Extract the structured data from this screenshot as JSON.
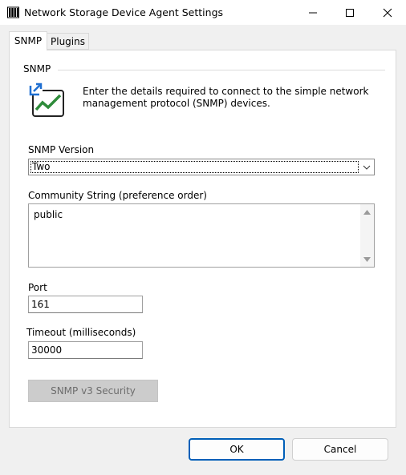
{
  "window": {
    "title": "Network Storage Device Agent Settings",
    "icon": "book-stack-icon",
    "controls": [
      "minimize-icon",
      "maximize-icon",
      "close-icon"
    ]
  },
  "tabs": [
    {
      "label": "SNMP",
      "selected": true
    },
    {
      "label": "Plugins",
      "selected": false
    }
  ],
  "snmp": {
    "group_label": "SNMP",
    "icon": "snmp-chart-icon",
    "intro": "Enter the details required to connect to the simple network management protocol (SNMP) devices.",
    "version": {
      "label": "SNMP Version",
      "value": "Two"
    },
    "community": {
      "label": "Community String (preference order)",
      "value": "public"
    },
    "port": {
      "label": "Port",
      "value": "161"
    },
    "timeout": {
      "label": "Timeout (milliseconds)",
      "value": "30000"
    },
    "v3_security_button": "SNMP v3 Security"
  },
  "footer": {
    "ok_label": "OK",
    "cancel_label": "Cancel"
  },
  "colors": {
    "accent": "#005fb8",
    "icon_blue": "#1f6fd1",
    "icon_green": "#2e8b3a"
  }
}
